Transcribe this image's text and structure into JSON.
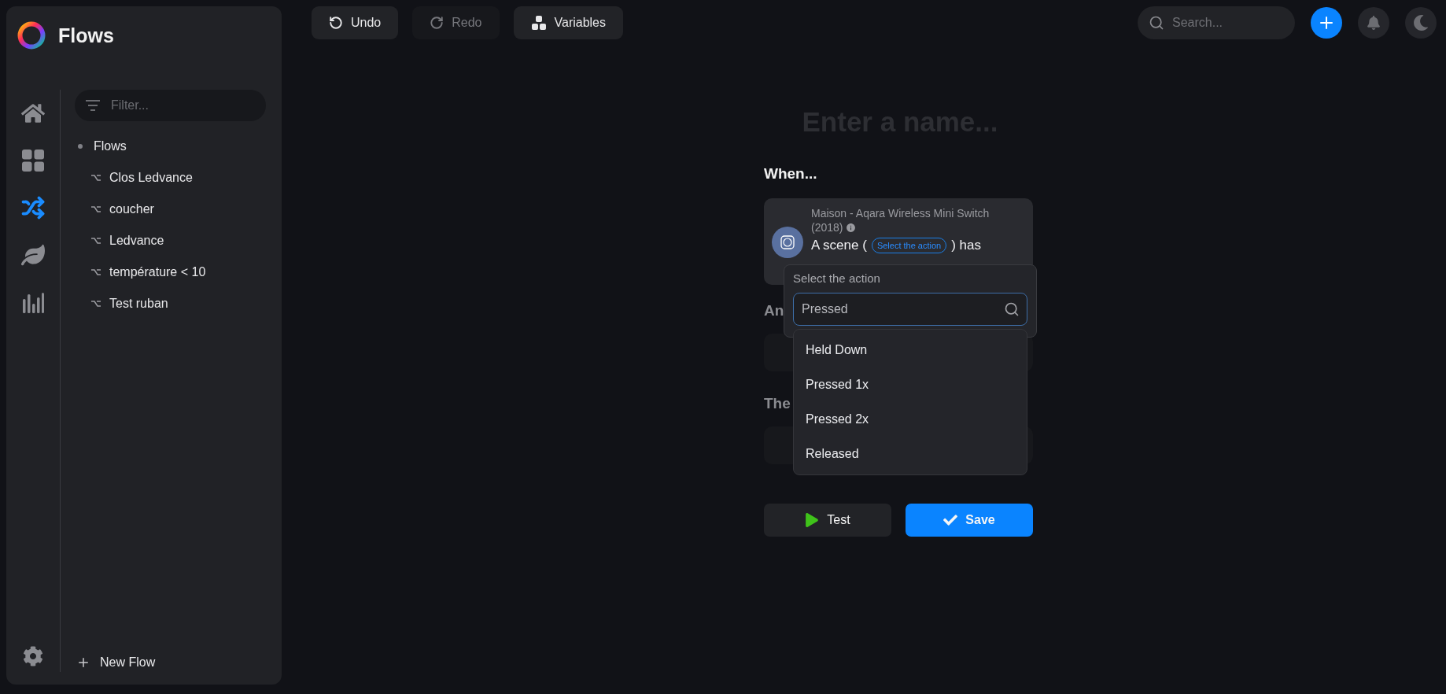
{
  "sidebar": {
    "title": "Flows",
    "nav": [
      {
        "selected": false
      },
      {
        "selected": false
      },
      {
        "selected": true
      },
      {
        "selected": false
      },
      {
        "selected": false
      }
    ],
    "filter": {
      "placeholder": "Filter..."
    },
    "tree": [
      {
        "label": "Flows",
        "children": [
          {
            "label": "Clos Ledvance"
          },
          {
            "label": "coucher"
          },
          {
            "label": "Ledvance"
          },
          {
            "label": "température < 10"
          },
          {
            "label": "Test ruban"
          }
        ]
      }
    ],
    "new_button": "New Flow"
  },
  "toolbar": {
    "buttons": [
      {
        "label": "Undo",
        "disabled": false
      },
      {
        "label": "Redo",
        "disabled": true
      },
      {
        "label": "Variables",
        "disabled": false
      }
    ]
  },
  "header": {
    "search": {
      "placeholder": "Search..."
    }
  },
  "editor": {
    "name_placeholder": "Enter a name...",
    "sections": [
      {
        "heading": "When...",
        "disabled": false
      },
      {
        "heading": "An",
        "disabled": true
      },
      {
        "heading": "The",
        "disabled": true
      }
    ],
    "trigger": {
      "device": "Maison - Aqara Wireless Mini Switch (2018)",
      "text_before": "A scene (",
      "chip": "Select the action",
      "text_after": ") has"
    },
    "dropdown": {
      "label": "Select the action",
      "value": "Pressed",
      "options": [
        "Held Down",
        "Pressed 1x",
        "Pressed 2x",
        "Released"
      ]
    },
    "actions": [
      {
        "label": "Test",
        "kind": "test"
      },
      {
        "label": "Save",
        "kind": "save"
      }
    ]
  }
}
